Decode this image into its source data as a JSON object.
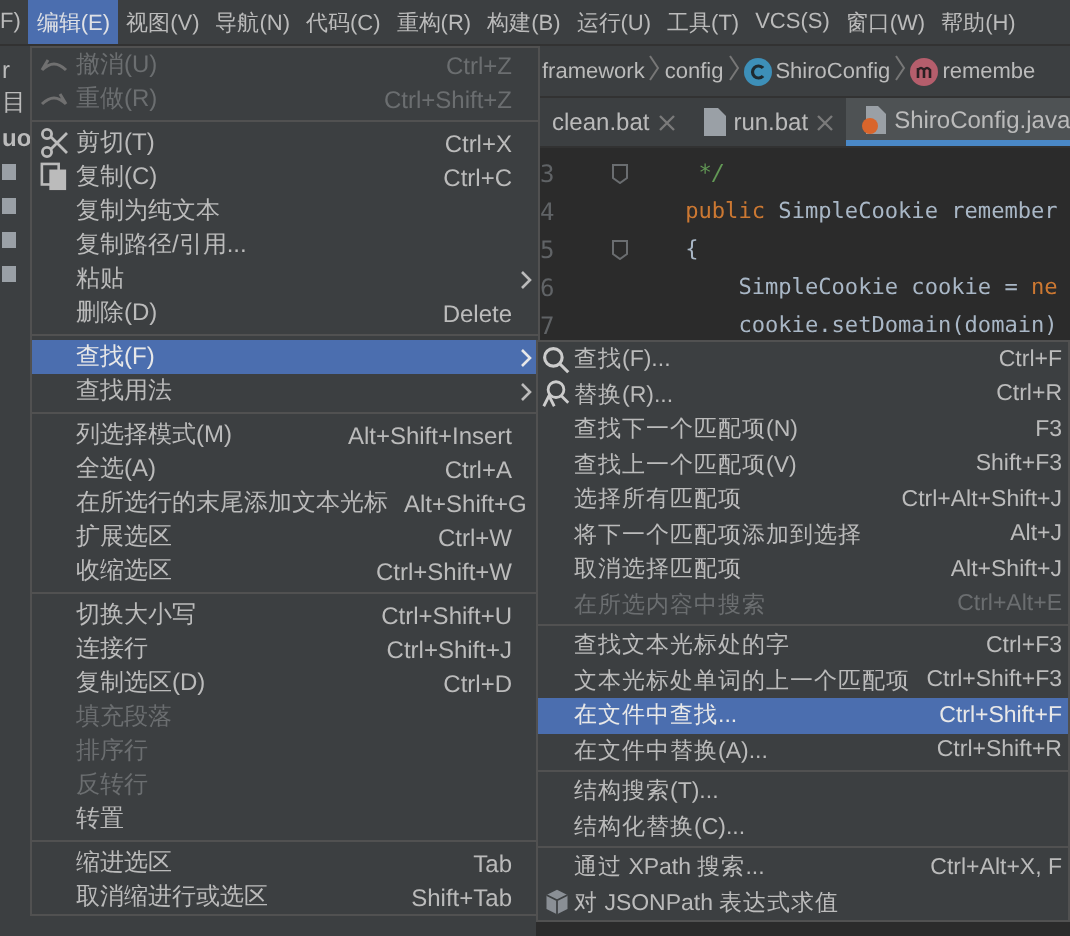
{
  "menubar": [
    {
      "label": "F)",
      "selected": false
    },
    {
      "label": "编辑(E)",
      "selected": true
    },
    {
      "label": "视图(V)",
      "selected": false
    },
    {
      "label": "导航(N)",
      "selected": false
    },
    {
      "label": "代码(C)",
      "selected": false
    },
    {
      "label": "重构(R)",
      "selected": false
    },
    {
      "label": "构建(B)",
      "selected": false
    },
    {
      "label": "运行(U)",
      "selected": false
    },
    {
      "label": "工具(T)",
      "selected": false
    },
    {
      "label": "VCS(S)",
      "selected": false
    },
    {
      "label": "窗口(W)",
      "selected": false
    },
    {
      "label": "帮助(H)",
      "selected": false
    }
  ],
  "project_panel": [
    {
      "label": "r",
      "kind": "plain"
    },
    {
      "label": "目",
      "kind": "plain"
    },
    {
      "label": "uo",
      "kind": "bold"
    },
    {
      "kind": "file"
    },
    {
      "kind": "file"
    },
    {
      "kind": "file"
    },
    {
      "kind": "file"
    }
  ],
  "breadcrumb": [
    {
      "label": "framework",
      "kind": "folder"
    },
    {
      "label": "config",
      "kind": "folder"
    },
    {
      "label": "ShiroConfig",
      "kind": "class"
    },
    {
      "label": "remembe",
      "kind": "method"
    }
  ],
  "tabs": [
    {
      "label": "clean.bat",
      "selected": false,
      "closable": true,
      "kind": "plain"
    },
    {
      "label": "run.bat",
      "selected": false,
      "closable": true,
      "kind": "file"
    },
    {
      "label": "ShiroConfig.java",
      "selected": true,
      "closable": false,
      "kind": "java"
    }
  ],
  "editor": {
    "lines": [
      {
        "number": "3",
        "fold": true,
        "tokens": [
          {
            "text": "     */",
            "kind": "comment"
          }
        ]
      },
      {
        "number": "4",
        "fold": false,
        "tokens": [
          {
            "text": "    public",
            "kind": "keyword"
          },
          {
            "text": " SimpleCookie remember",
            "kind": "plain"
          }
        ]
      },
      {
        "number": "5",
        "fold": true,
        "tokens": [
          {
            "text": "    {",
            "kind": "plain"
          }
        ]
      },
      {
        "number": "6",
        "fold": false,
        "tokens": [
          {
            "text": "        SimpleCookie cookie = ",
            "kind": "plain"
          },
          {
            "text": "ne",
            "kind": "keyword"
          }
        ]
      },
      {
        "number": "7",
        "fold": false,
        "tokens": [
          {
            "text": "        cookie.setDomain(domain)",
            "kind": "plain"
          }
        ]
      }
    ]
  },
  "edit_menu": {
    "items": [
      {
        "kind": "undo",
        "label": "撤消(U)",
        "shortcut": "Ctrl+Z",
        "disabled": true,
        "selected": false,
        "submenu": false
      },
      {
        "kind": "redo",
        "label": "重做(R)",
        "shortcut": "Ctrl+Shift+Z",
        "disabled": true,
        "selected": false,
        "submenu": false
      },
      {
        "kind": "separator"
      },
      {
        "kind": "cut",
        "label": "剪切(T)",
        "shortcut": "Ctrl+X",
        "disabled": false,
        "selected": false,
        "submenu": false
      },
      {
        "kind": "copy",
        "label": "复制(C)",
        "shortcut": "Ctrl+C",
        "disabled": false,
        "selected": false,
        "submenu": false
      },
      {
        "kind": "item",
        "label": "复制为纯文本",
        "disabled": false,
        "selected": false,
        "submenu": false
      },
      {
        "kind": "item",
        "label": "复制路径/引用...",
        "disabled": false,
        "selected": false,
        "submenu": false
      },
      {
        "kind": "item",
        "label": "粘贴",
        "disabled": false,
        "selected": false,
        "submenu": true
      },
      {
        "kind": "item",
        "label": "删除(D)",
        "shortcut": "Delete",
        "disabled": false,
        "selected": false,
        "submenu": false
      },
      {
        "kind": "separator"
      },
      {
        "kind": "item",
        "label": "查找(F)",
        "disabled": false,
        "selected": true,
        "submenu": true
      },
      {
        "kind": "item",
        "label": "查找用法",
        "disabled": false,
        "selected": false,
        "submenu": true
      },
      {
        "kind": "separator"
      },
      {
        "kind": "item",
        "label": "列选择模式(M)",
        "shortcut": "Alt+Shift+Insert",
        "disabled": false,
        "selected": false,
        "submenu": false
      },
      {
        "kind": "item",
        "label": "全选(A)",
        "shortcut": "Ctrl+A",
        "disabled": false,
        "selected": false,
        "submenu": false
      },
      {
        "kind": "item",
        "label": "在所选行的末尾添加文本光标",
        "shortcut": "Alt+Shift+G",
        "disabled": false,
        "selected": false,
        "submenu": false
      },
      {
        "kind": "item",
        "label": "扩展选区",
        "shortcut": "Ctrl+W",
        "disabled": false,
        "selected": false,
        "submenu": false
      },
      {
        "kind": "item",
        "label": "收缩选区",
        "shortcut": "Ctrl+Shift+W",
        "disabled": false,
        "selected": false,
        "submenu": false
      },
      {
        "kind": "separator"
      },
      {
        "kind": "item",
        "label": "切换大小写",
        "shortcut": "Ctrl+Shift+U",
        "disabled": false,
        "selected": false,
        "submenu": false
      },
      {
        "kind": "item",
        "label": "连接行",
        "shortcut": "Ctrl+Shift+J",
        "disabled": false,
        "selected": false,
        "submenu": false
      },
      {
        "kind": "item",
        "label": "复制选区(D)",
        "shortcut": "Ctrl+D",
        "disabled": false,
        "selected": false,
        "submenu": false
      },
      {
        "kind": "item",
        "label": "填充段落",
        "disabled": true,
        "selected": false,
        "submenu": false
      },
      {
        "kind": "item",
        "label": "排序行",
        "disabled": true,
        "selected": false,
        "submenu": false
      },
      {
        "kind": "item",
        "label": "反转行",
        "disabled": true,
        "selected": false,
        "submenu": false
      },
      {
        "kind": "item",
        "label": "转置",
        "disabled": false,
        "selected": false,
        "submenu": false
      },
      {
        "kind": "separator"
      },
      {
        "kind": "item",
        "label": "缩进选区",
        "shortcut": "Tab",
        "disabled": false,
        "selected": false,
        "submenu": false
      },
      {
        "kind": "item",
        "label": "取消缩进行或选区",
        "shortcut": "Shift+Tab",
        "disabled": false,
        "selected": false,
        "submenu": false
      }
    ]
  },
  "find_submenu": {
    "items": [
      {
        "kind": "find",
        "label": "查找(F)...",
        "shortcut": "Ctrl+F",
        "disabled": false,
        "selected": false
      },
      {
        "kind": "replace",
        "label": "替换(R)...",
        "shortcut": "Ctrl+R",
        "disabled": false,
        "selected": false
      },
      {
        "kind": "item",
        "label": "查找下一个匹配项(N)",
        "shortcut": "F3",
        "disabled": false,
        "selected": false
      },
      {
        "kind": "item",
        "label": "查找上一个匹配项(V)",
        "shortcut": "Shift+F3",
        "disabled": false,
        "selected": false
      },
      {
        "kind": "item",
        "label": "选择所有匹配项",
        "shortcut": "Ctrl+Alt+Shift+J",
        "disabled": false,
        "selected": false
      },
      {
        "kind": "item",
        "label": "将下一个匹配项添加到选择",
        "shortcut": "Alt+J",
        "disabled": false,
        "selected": false
      },
      {
        "kind": "item",
        "label": "取消选择匹配项",
        "shortcut": "Alt+Shift+J",
        "disabled": false,
        "selected": false
      },
      {
        "kind": "item",
        "label": "在所选内容中搜索",
        "shortcut": "Ctrl+Alt+E",
        "disabled": true,
        "selected": false
      },
      {
        "kind": "separator"
      },
      {
        "kind": "item",
        "label": "查找文本光标处的字",
        "shortcut": "Ctrl+F3",
        "disabled": false,
        "selected": false
      },
      {
        "kind": "item",
        "label": "文本光标处单词的上一个匹配项",
        "shortcut": "Ctrl+Shift+F3",
        "disabled": false,
        "selected": false
      },
      {
        "kind": "item",
        "label": "在文件中查找...",
        "shortcut": "Ctrl+Shift+F",
        "disabled": false,
        "selected": true
      },
      {
        "kind": "item",
        "label": "在文件中替换(A)...",
        "shortcut": "Ctrl+Shift+R",
        "disabled": false,
        "selected": false
      },
      {
        "kind": "separator"
      },
      {
        "kind": "item",
        "label": "结构搜索(T)...",
        "disabled": false,
        "selected": false
      },
      {
        "kind": "item",
        "label": "结构化替换(C)...",
        "disabled": false,
        "selected": false
      },
      {
        "kind": "separator"
      },
      {
        "kind": "item",
        "label": "通过 XPath 搜索...",
        "shortcut": "Ctrl+Alt+X, F",
        "disabled": false,
        "selected": false
      },
      {
        "kind": "json",
        "label": "对 JSONPath 表达式求值",
        "disabled": false,
        "selected": false
      }
    ]
  }
}
